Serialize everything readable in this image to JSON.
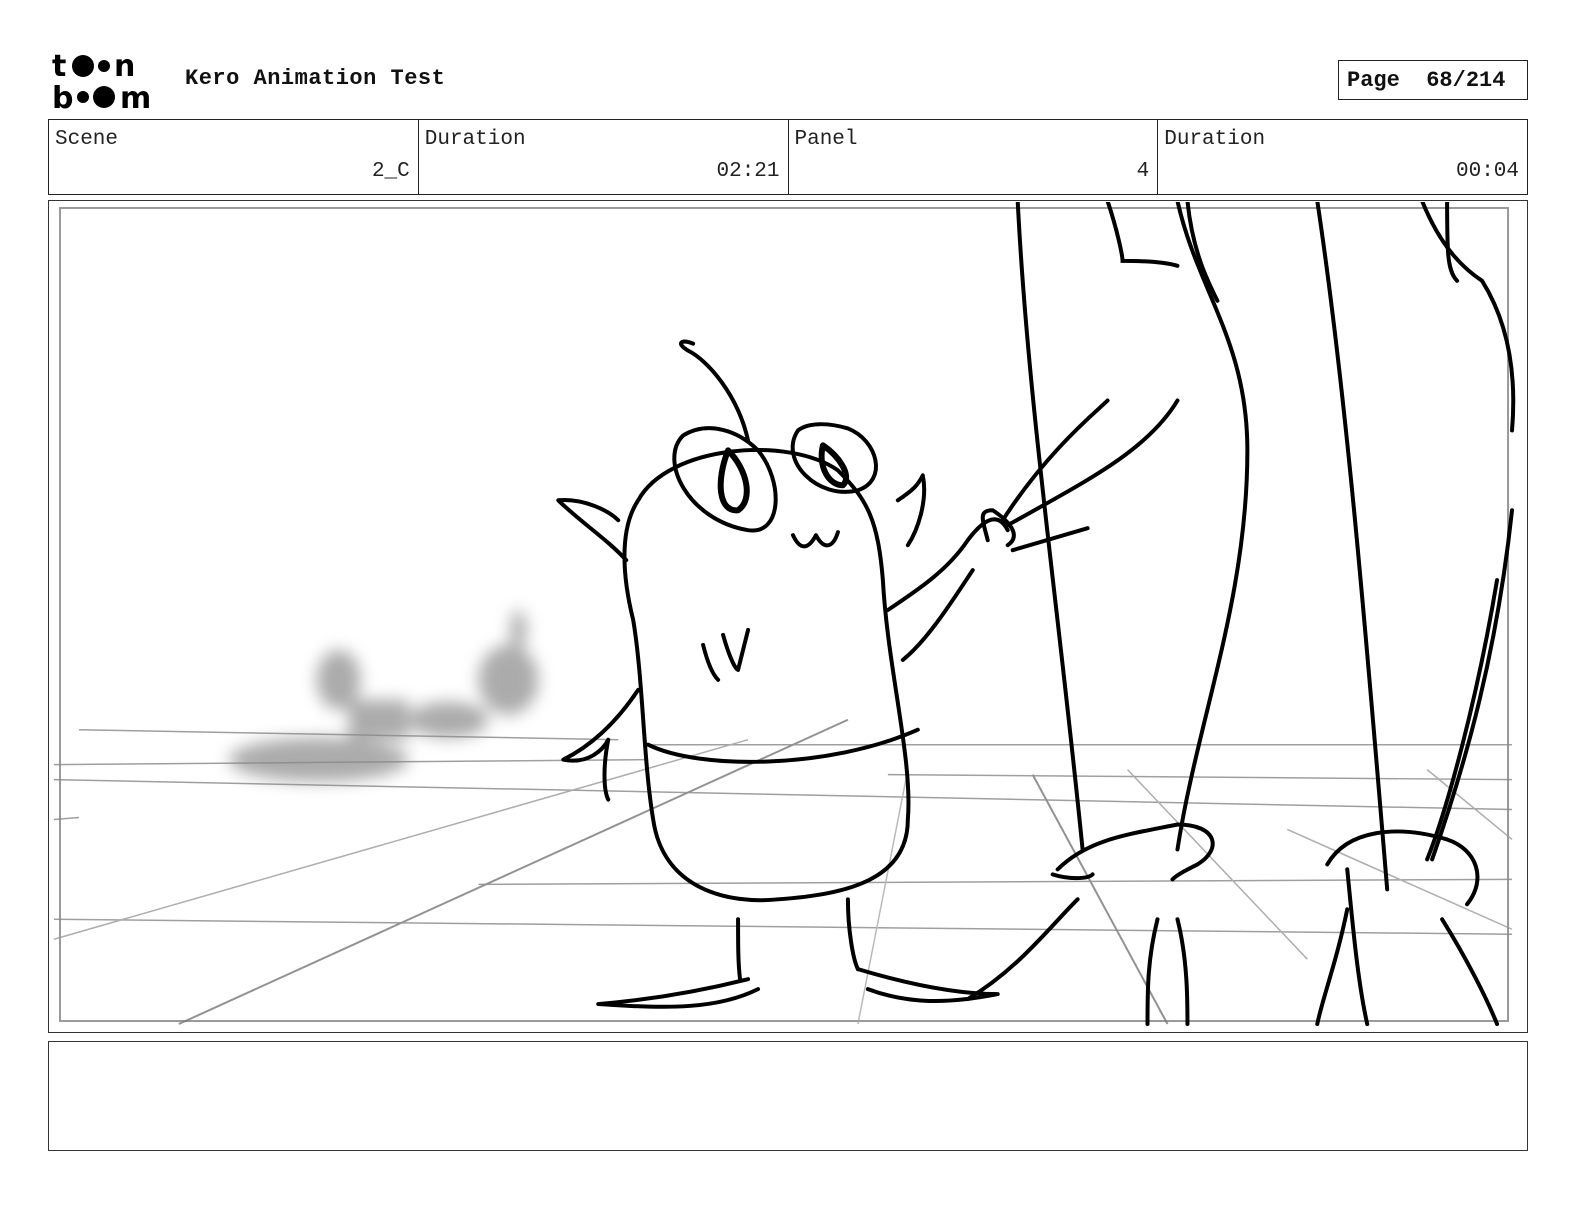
{
  "header": {
    "logo_text": "toon boom",
    "project_title": "Kero Animation Test",
    "page_label": "Page",
    "page_number": "68/214"
  },
  "info": {
    "scene_label": "Scene",
    "scene_value": "2_C",
    "scene_duration_label": "Duration",
    "scene_duration_value": "02:21",
    "panel_label": "Panel",
    "panel_value": "4",
    "panel_duration_label": "Duration",
    "panel_duration_value": "00:04"
  },
  "panel": {
    "image_type": "storyboard-sketch"
  },
  "notes": {
    "text": ""
  }
}
